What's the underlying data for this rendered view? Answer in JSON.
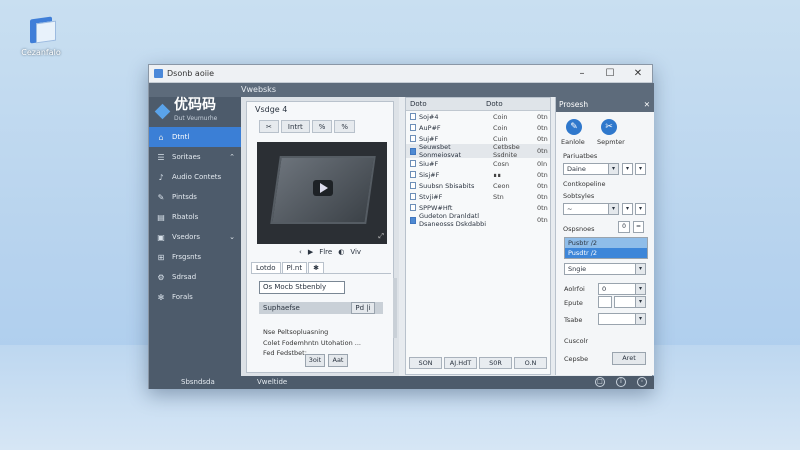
{
  "desktop": {
    "icon_label": "Cezanfalo"
  },
  "window": {
    "title": "Dsonb aoiie",
    "controls": [
      "–",
      "☐",
      "✕"
    ]
  },
  "menubar": {
    "label": "Vwebsks"
  },
  "sidebar": {
    "brand_name": "优码码",
    "brand_sub": "Dut Veumurhe",
    "items": [
      {
        "label": "Dtntl",
        "icon": "home-icon",
        "symbol": "⌂",
        "active": true
      },
      {
        "label": "Soritaes",
        "icon": "list-icon",
        "symbol": "☰",
        "chevron": "⌃"
      },
      {
        "label": "Audio Contets",
        "icon": "audio-icon",
        "symbol": "♪"
      },
      {
        "label": "Pintsds",
        "icon": "pen-icon",
        "symbol": "✎"
      },
      {
        "label": "Rbatols",
        "icon": "document-icon",
        "symbol": "▤"
      },
      {
        "label": "Vsedors",
        "icon": "video-icon",
        "symbol": "▣",
        "chevron": "⌄"
      },
      {
        "label": "Frsgsnts",
        "icon": "fragments-icon",
        "symbol": "⊞"
      },
      {
        "label": "Sdrsad",
        "icon": "settings-icon",
        "symbol": "⚙"
      },
      {
        "label": "Forals",
        "icon": "gear-icon",
        "symbol": "✻"
      }
    ],
    "footer": "Sbsndsda"
  },
  "bottom": {
    "label": "Vweltide"
  },
  "panel1": {
    "title": "Vsdge 4",
    "tools": [
      "✂",
      "Intrt",
      "%",
      "%"
    ],
    "video_controls": {
      "prev": "‹",
      "play": "▶",
      "label1": "Flre",
      "record": "◐",
      "label2": "Viv"
    },
    "tabs": [
      "Lotdo",
      "Pl.nt",
      "✱"
    ],
    "field_value": "Os Mocb Stbenbly",
    "row_label": "Suphaefse",
    "row_button": "Pd |i",
    "text_lines": [
      "Nse Peltsopluasning",
      "Colet Fodemhntn Utohation ...",
      "Fed Fedstbet;"
    ],
    "buttons": [
      "3oit",
      "Aat"
    ]
  },
  "panel2": {
    "headers": [
      "Doto",
      "Doto"
    ],
    "files": [
      {
        "name": "Soj#4",
        "col": "Coin",
        "size": "0tn",
        "icon": "file-icon"
      },
      {
        "name": "AuP#F",
        "col": "Coin",
        "size": "0tn",
        "icon": "file-icon"
      },
      {
        "name": "Suj#F",
        "col": "Cuin",
        "size": "0tn",
        "icon": "file-icon"
      },
      {
        "name": "Seuwsbet Sonmeiosvat",
        "col": "Cetbsbe Ssdnite",
        "size": "0tn",
        "icon": "document-blue-icon",
        "blue": true,
        "selected": true
      },
      {
        "name": "Siu#F",
        "col": "Cosn",
        "size": "0ln",
        "icon": "file-icon"
      },
      {
        "name": "Sisj#F",
        "col": "∎∎",
        "size": "0tn",
        "icon": "file-icon"
      },
      {
        "name": "Suubsn Sbisabits",
        "col": "Ceon",
        "size": "0tn",
        "icon": "file-icon"
      },
      {
        "name": "Stvji#F",
        "col": "Stn",
        "size": "0tn",
        "icon": "file-icon"
      },
      {
        "name": "SPPW#Hft",
        "col": "",
        "size": "0tn",
        "icon": "file-icon"
      },
      {
        "name": "Gudeton Dranldatl Dsaneosss Dskdabbi",
        "col": "",
        "size": "0tn",
        "icon": "document-blue-icon",
        "blue": true
      }
    ],
    "footer_buttons": [
      "SON",
      "AJ.HdT",
      "S0R",
      "O.N"
    ]
  },
  "panel3": {
    "title": "Prosesh",
    "btn1": "Eanlole",
    "btn2": "Sepmter",
    "label_a": "Pariuatbes",
    "combo_a": "Daine",
    "label_b": "Contkopeline",
    "label_c": "Sobtsyles",
    "combo_c": "~",
    "label_d": "Ospsnoes",
    "spin_value": "0",
    "list": [
      "Pusbtr /2",
      "Pusdtr /2"
    ],
    "select_a": "Sngie",
    "label_e": "Aolrfoi",
    "combo_e": "0",
    "label_f": "Epute",
    "label_g": "Tsabe",
    "label_h": "Cuscolr",
    "label_i": "Cepsbe",
    "btn_ok": "Aret"
  }
}
